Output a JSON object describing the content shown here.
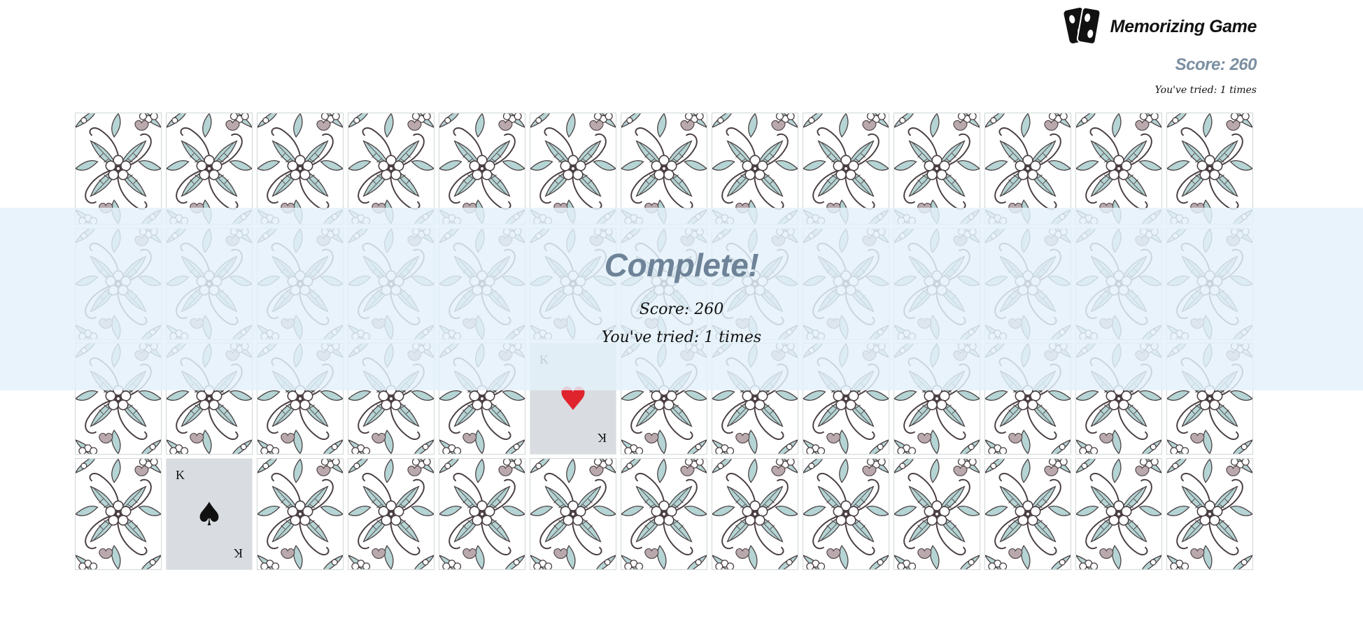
{
  "app": {
    "title": "Memorizing Game",
    "icon": "cards-icon"
  },
  "header": {
    "score_text": "Score: 260",
    "tries_text": "You've tried: 1 times"
  },
  "overlay": {
    "title": "Complete!",
    "score_text": "Score: 260",
    "tries_text": "You've tried: 1 times"
  },
  "board": {
    "rows": 4,
    "cols": 13,
    "card_back_pattern": "floral-tile",
    "face_up_cards": [
      {
        "row": 3,
        "col": 6,
        "rank": "K",
        "suit": "hearts",
        "symbol": "♥",
        "color": "#e0242e"
      },
      {
        "row": 4,
        "col": 2,
        "rank": "K",
        "suit": "spades",
        "symbol": "♠",
        "color": "#111111"
      }
    ]
  },
  "colors": {
    "accent": "#7b8fa1",
    "overlay_title": "#6e8397",
    "overlay_bg": "#e3f1fa",
    "card_face": "#d9dde1",
    "leaf_fill": "#b5d4d4",
    "line": "#4a3f42"
  }
}
